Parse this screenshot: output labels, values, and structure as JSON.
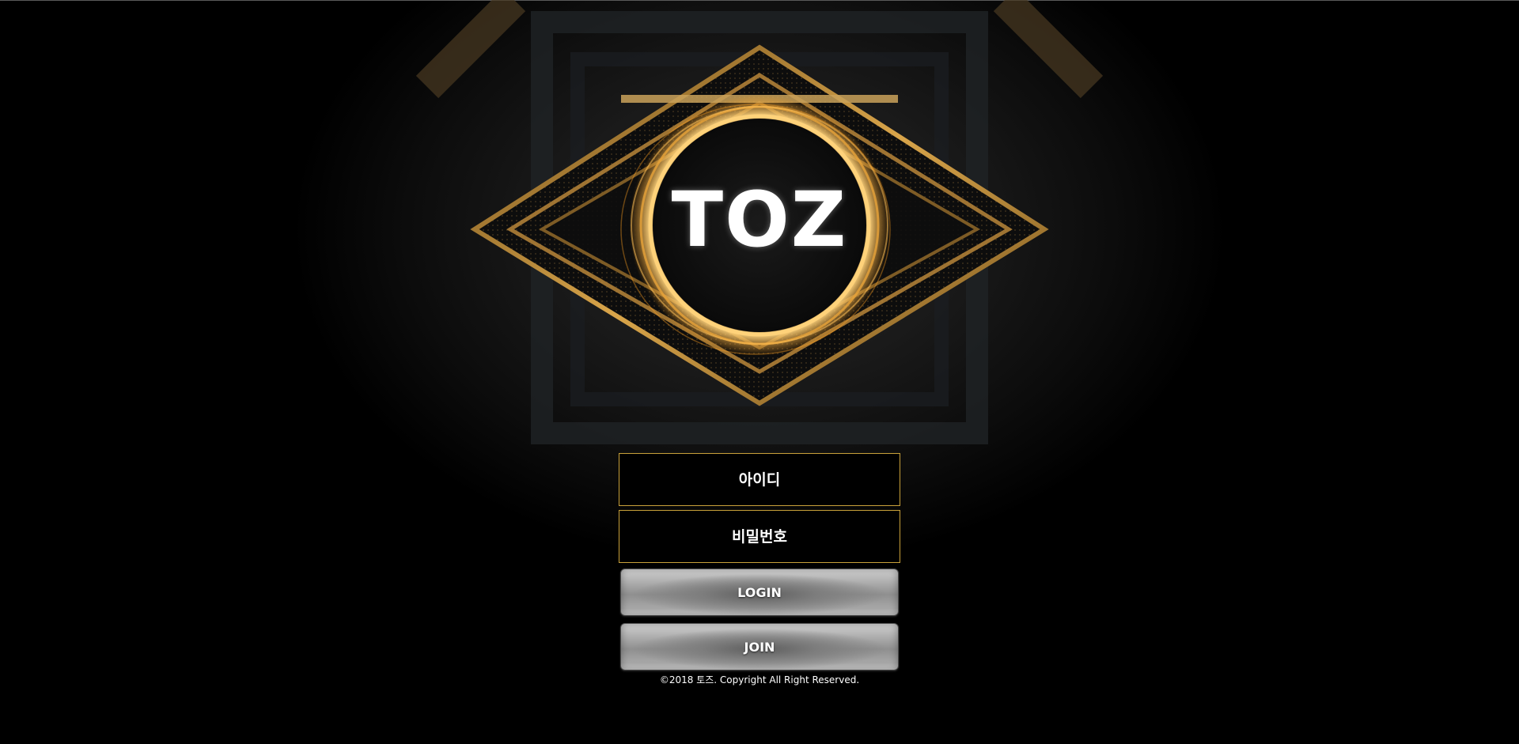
{
  "brand": {
    "logo_text": "TOZ"
  },
  "login_form": {
    "id_placeholder": "아이디",
    "password_placeholder": "비밀번호",
    "login_label": "LOGIN",
    "join_label": "JOIN"
  },
  "footer": {
    "copyright": "©2018 토즈. Copyright All Right Reserved."
  },
  "colors": {
    "background": "#000000",
    "gold_accent": "#c9a13a",
    "button_silver": "#a8a8a8"
  }
}
